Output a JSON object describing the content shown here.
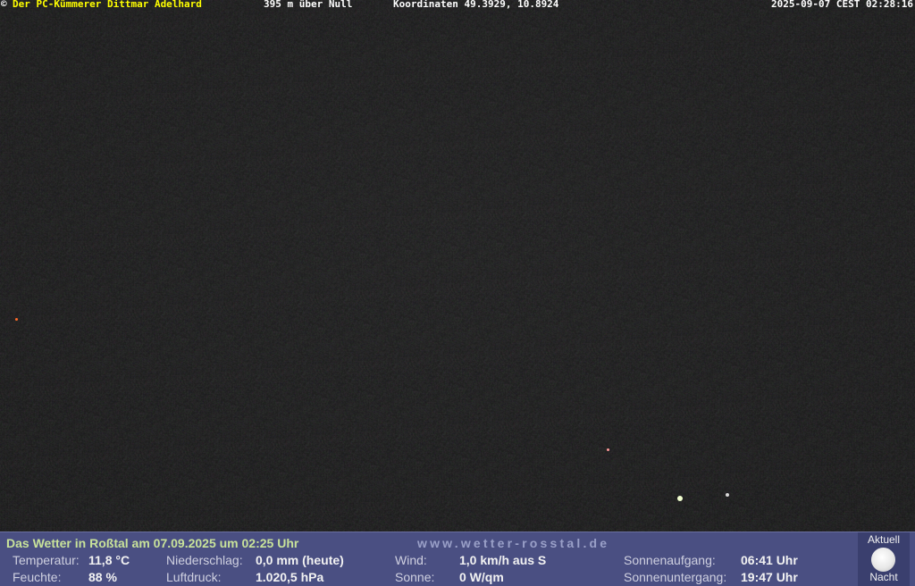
{
  "overlay": {
    "copyright_symbol": "©",
    "owner": "Der PC-Kümmerer Dittmar Adelhard",
    "altitude": "395 m über Null",
    "coordinates": "Koordinaten 49.3929, 10.8924",
    "timestamp": "2025-09-07 CEST 02:28:16"
  },
  "weather": {
    "headline": "Das Wetter in Roßtal am 07.09.2025 um 02:25 Uhr",
    "website": "www.wetter-rosstal.de",
    "temperature_label": "Temperatur:",
    "temperature_value": "11,8 °C",
    "humidity_label": "Feuchte:",
    "humidity_value": "88 %",
    "precipitation_label": "Niederschlag:",
    "precipitation_value": "0,0 mm (heute)",
    "pressure_label": "Luftdruck:",
    "pressure_value": "1.020,5 hPa",
    "wind_label": "Wind:",
    "wind_value": "1,0 km/h aus S",
    "sun_label": "Sonne:",
    "sun_value": "0 W/qm",
    "sunrise_label": "Sonnenaufgang:",
    "sunrise_value": "06:41 Uhr",
    "sunset_label": "Sonnenuntergang:",
    "sunset_value": "19:47 Uhr"
  },
  "moon": {
    "top_label": "Aktuell",
    "bottom_label": "Nacht",
    "icon": "full-moon-icon"
  },
  "colors": {
    "panel_background": "#4a4f82",
    "headline": "#c8e29a",
    "owner_text": "#ffff00"
  }
}
